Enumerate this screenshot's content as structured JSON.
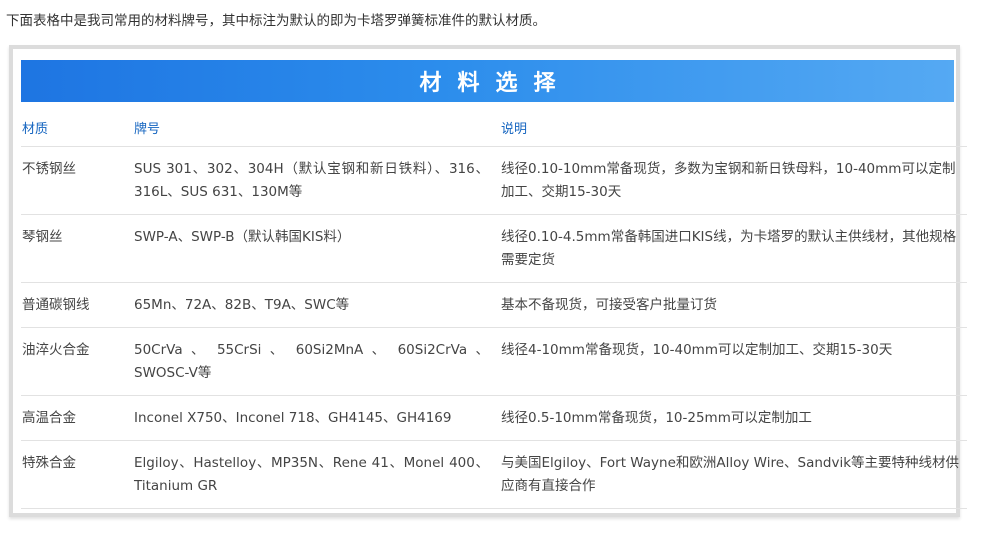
{
  "intro": "下面表格中是我司常用的材料牌号，其中标注为默认的即为卡塔罗弹簧标准件的默认材质。",
  "banner_title": "材料选择",
  "table": {
    "headers": [
      "材质",
      "牌号",
      "说明"
    ],
    "rows": [
      [
        "不锈钢丝",
        "SUS 301、302、304H（默认宝钢和新日铁料）、316、316L、SUS 631、130M等",
        "线径0.10-10mm常备现货，多数为宝钢和新日铁母料，10-40mm可以定制加工、交期15-30天"
      ],
      [
        "琴钢丝",
        "SWP-A、SWP-B（默认韩国KIS料）",
        "线径0.10-4.5mm常备韩国进口KIS线，为卡塔罗的默认主供线材，其他规格需要定货"
      ],
      [
        "普通碳钢线",
        "65Mn、72A、82B、T9A、SWC等",
        "基本不备现货，可接受客户批量订货"
      ],
      [
        "油淬火合金",
        "50CrVa 、 55CrSi 、 60Si2MnA 、 60Si2CrVa 、 SWOSC-V等",
        "线径4-10mm常备现货，10-40mm可以定制加工、交期15-30天"
      ],
      [
        "高温合金",
        "Inconel X750、Inconel 718、GH4145、GH4169",
        "线径0.5-10mm常备现货，10-25mm可以定制加工"
      ],
      [
        "特殊合金",
        "Elgiloy、Hastelloy、MP35N、Rene 41、Monel 400、Titanium GR",
        "与美国Elgiloy、Fort Wayne和欧洲Alloy Wire、Sandvik等主要特种线材供应商有直接合作"
      ]
    ]
  },
  "colors": {
    "header_text": "#1565c0",
    "banner_start": "#1e75e2",
    "banner_end": "#55a9f3"
  }
}
